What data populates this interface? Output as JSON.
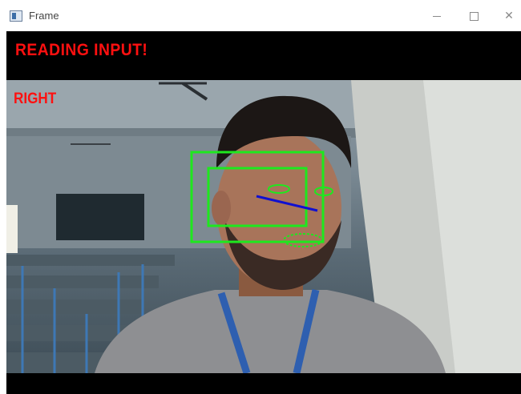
{
  "window": {
    "title": "Frame",
    "icon": "app-window-icon",
    "controls": {
      "minimize": "minimize-icon",
      "maximize": "maximize-icon",
      "close": "close-icon"
    }
  },
  "overlay": {
    "status_text": "READING INPUT!",
    "direction_text": "RIGHT",
    "text_color": "#ff1010",
    "box_color": "#1ee81e",
    "gaze_line_color": "#1010d0"
  }
}
